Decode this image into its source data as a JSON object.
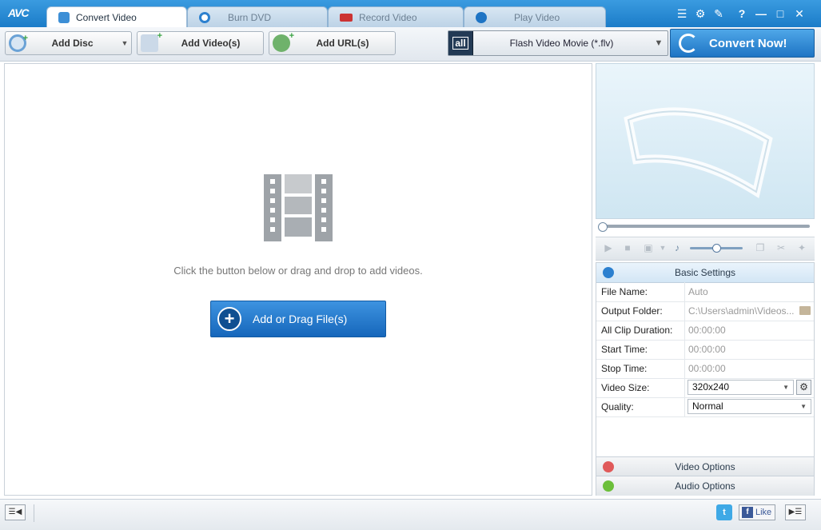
{
  "app": {
    "logo": "AVC"
  },
  "tabs": [
    {
      "label": "Convert Video",
      "active": true
    },
    {
      "label": "Burn DVD",
      "active": false
    },
    {
      "label": "Record Video",
      "active": false
    },
    {
      "label": "Play Video",
      "active": false
    }
  ],
  "window_controls": [
    "menu-icon",
    "settings-icon",
    "skin-icon",
    "help-icon",
    "minimize-icon",
    "maximize-icon",
    "close-icon"
  ],
  "toolbar": {
    "add_disc": "Add Disc",
    "add_videos": "Add Video(s)",
    "add_url": "Add URL(s)",
    "profile_all": "all",
    "profile": "Flash Video Movie (*.flv)",
    "convert": "Convert Now!"
  },
  "main": {
    "hint": "Click the button below or drag and drop to add videos.",
    "add_button": "Add or Drag File(s)"
  },
  "settings": {
    "title": "Basic Settings",
    "rows": [
      {
        "key": "File Name:",
        "value": "Auto"
      },
      {
        "key": "Output Folder:",
        "value": "C:\\Users\\admin\\Videos..."
      },
      {
        "key": "All Clip Duration:",
        "value": "00:00:00"
      },
      {
        "key": "Start Time:",
        "value": "00:00:00"
      },
      {
        "key": "Stop Time:",
        "value": "00:00:00"
      },
      {
        "key": "Video Size:",
        "value": "320x240"
      },
      {
        "key": "Quality:",
        "value": "Normal"
      }
    ],
    "video_options": "Video Options",
    "audio_options": "Audio Options"
  },
  "statusbar": {
    "twitter": "t",
    "facebook_like": "Like",
    "facebook_f": "f"
  },
  "colors": {
    "accent": "#1e74c4",
    "titlebar": "#2a8bd6"
  }
}
